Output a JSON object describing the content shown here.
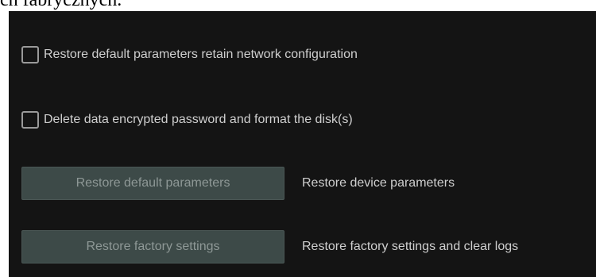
{
  "page": {
    "top_caption": "ch fabrycznych."
  },
  "options": [
    {
      "label": "Restore default parameters retain network configuration",
      "checked": false
    },
    {
      "label": "Delete data encrypted password and format the disk(s)",
      "checked": false
    }
  ],
  "actions": [
    {
      "button_label": "Restore default parameters",
      "description": "Restore device parameters"
    },
    {
      "button_label": "Restore factory settings",
      "description": "Restore factory settings and clear logs"
    }
  ],
  "colors": {
    "panel_background": "#141414",
    "button_background": "#3d4a48",
    "text": "#cfcfcf",
    "button_text": "#8e9896"
  }
}
